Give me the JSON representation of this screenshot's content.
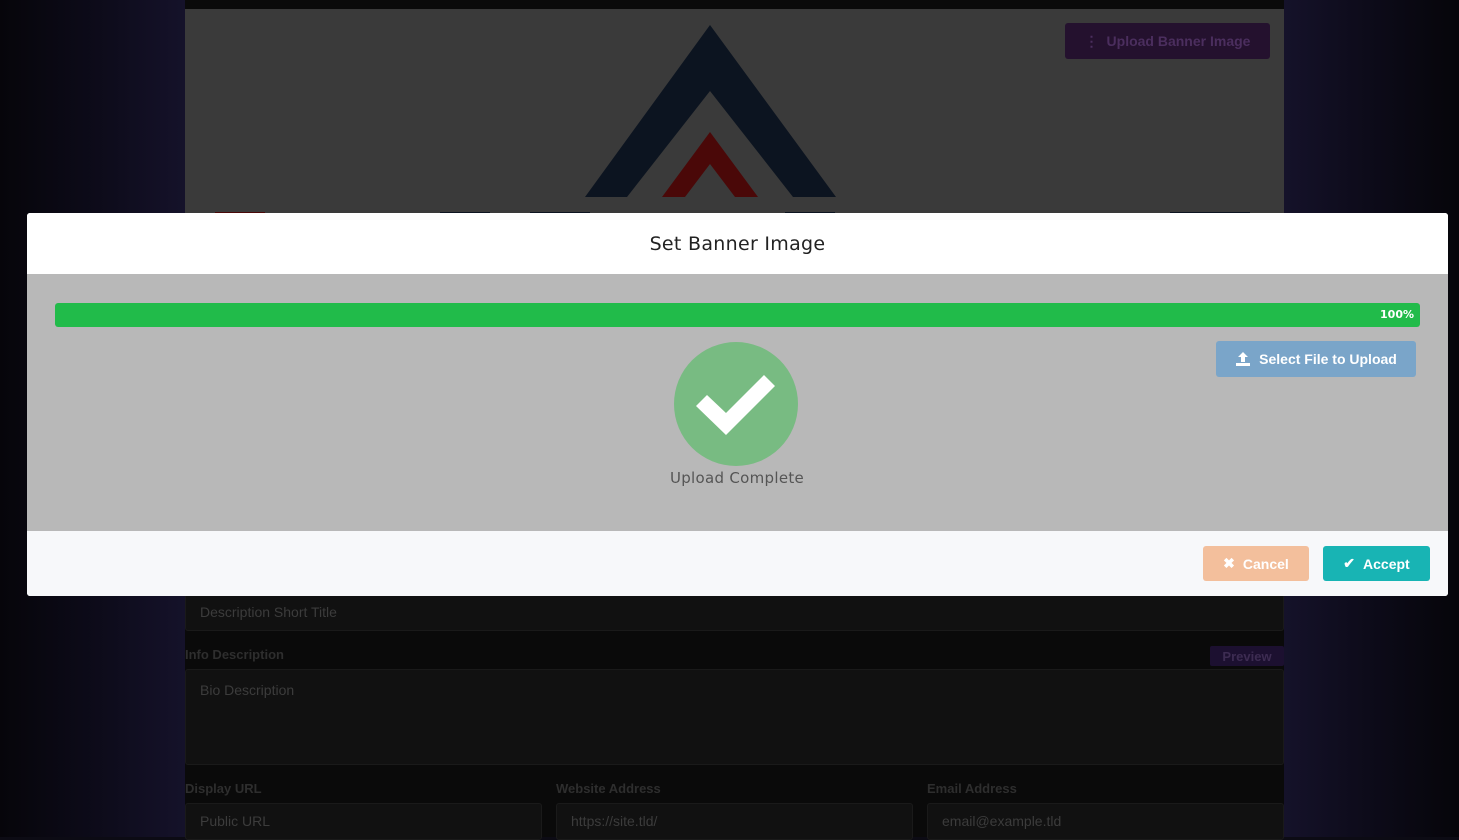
{
  "background": {
    "upload_banner_label": "Upload Banner Image",
    "description_short_title_placeholder": "Description Short Title",
    "info_description_label": "Info Description",
    "preview_label": "Preview",
    "bio_description_placeholder": "Bio Description",
    "display_url_label": "Display URL",
    "display_url_placeholder": "Public URL",
    "website_address_label": "Website Address",
    "website_address_placeholder": "https://site.tld/",
    "email_address_label": "Email Address",
    "email_address_placeholder": "email@example.tld"
  },
  "modal": {
    "title": "Set Banner Image",
    "progress": {
      "value": 100,
      "label": "100%",
      "color": "#21bb4a"
    },
    "select_file_label": "Select File to Upload",
    "status_text": "Upload Complete",
    "footer": {
      "cancel_label": "Cancel",
      "accept_label": "Accept"
    }
  },
  "icons": {
    "upload_banner": "ellipsis-vertical-icon",
    "select_file": "upload-icon",
    "status": "checkmark-icon",
    "cancel": "times-icon",
    "accept": "check-icon"
  },
  "colors": {
    "accept": "#18b4b4",
    "cancel": "#f3bf9c",
    "select_file": "#7aa5c9",
    "success": "#78bb82"
  }
}
